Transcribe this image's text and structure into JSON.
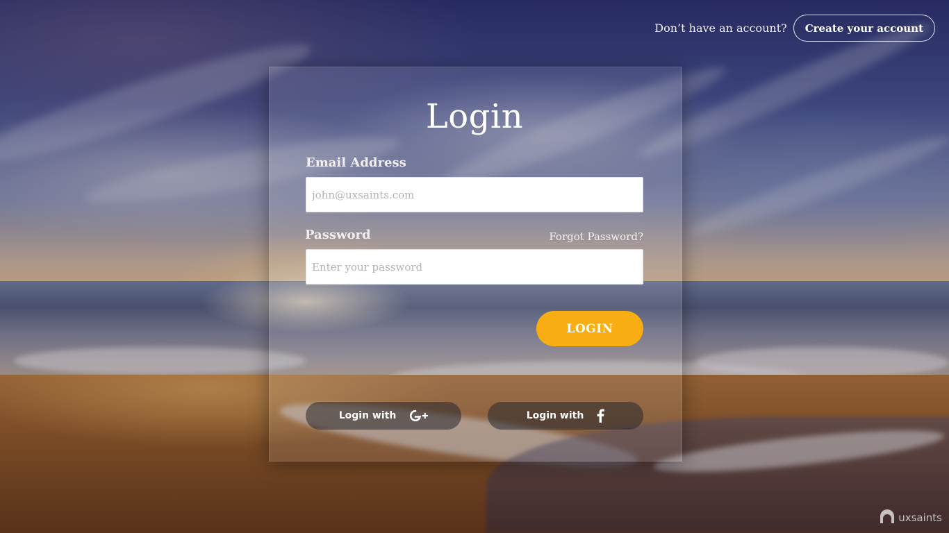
{
  "header": {
    "prompt_text": "Don’t have an account?",
    "create_account_label": "Create your account"
  },
  "form": {
    "title": "Login",
    "email_label": "Email Address",
    "email_placeholder": "john@uxsaints.com",
    "password_label": "Password",
    "password_placeholder": "Enter your password",
    "forgot_label": "Forgot Password?",
    "login_label": "LOGIN"
  },
  "social": {
    "google_label": "Login with",
    "google_icon": "google-plus-icon",
    "facebook_label": "Login with",
    "facebook_icon": "facebook-icon"
  },
  "brand": {
    "logo_text": "uxsaints",
    "logo_icon": "uxsaints-logo-icon"
  },
  "colors": {
    "accent": "#f8ae13",
    "social_button_bg": "#28282d"
  }
}
